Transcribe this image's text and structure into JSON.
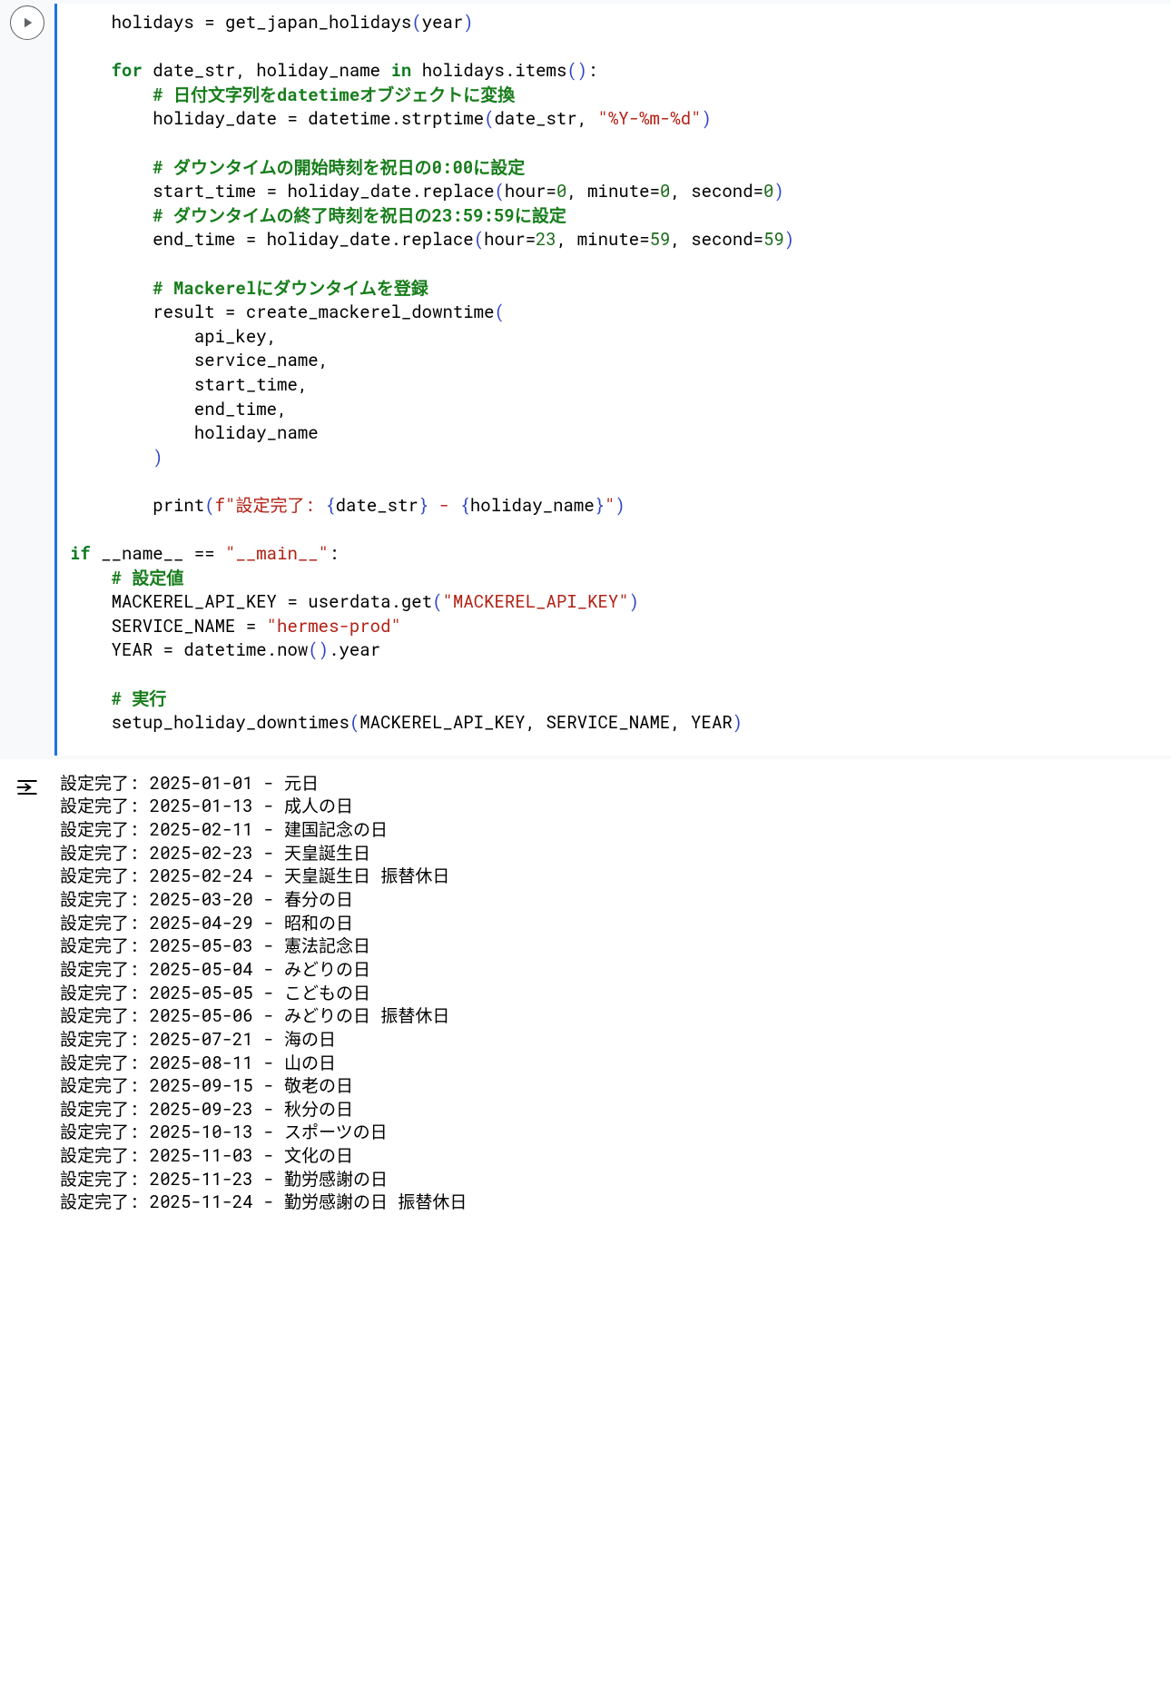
{
  "code": {
    "l01p1": "    holidays ",
    "l01p2": "=",
    "l01p3": " get_japan_holidays",
    "l01p4": "(",
    "l01p5": "year",
    "l01p6": ")",
    "blank": "",
    "l03p1": "    ",
    "l03p2": "for",
    "l03p3": " date_str",
    "l03p4": ",",
    "l03p5": " holiday_name ",
    "l03p6": "in",
    "l03p7": " holidays",
    "l03p8": ".",
    "l03p9": "items",
    "l03p10": "(",
    "l03p11": ")",
    "l03p12": ":",
    "l04p1": "        ",
    "l04p2": "# 日付文字列をdatetimeオブジェクトに変換",
    "l05p1": "        holiday_date ",
    "l05p2": "=",
    "l05p3": " datetime",
    "l05p4": ".",
    "l05p5": "strptime",
    "l05p6": "(",
    "l05p7": "date_str",
    "l05p8": ",",
    "l05p9": " ",
    "l05p10": "\"%Y-%m-%d\"",
    "l05p11": ")",
    "l07p1": "        ",
    "l07p2": "# ダウンタイムの開始時刻を祝日の0:00に設定",
    "l08p1": "        start_time ",
    "l08p2": "=",
    "l08p3": " holiday_date",
    "l08p4": ".",
    "l08p5": "replace",
    "l08p6": "(",
    "l08p7": "hour",
    "l08p8": "=",
    "l08p9": "0",
    "l08p10": ",",
    "l08p11": " minute",
    "l08p12": "=",
    "l08p13": "0",
    "l08p14": ",",
    "l08p15": " second",
    "l08p16": "=",
    "l08p17": "0",
    "l08p18": ")",
    "l09p1": "        ",
    "l09p2": "# ダウンタイムの終了時刻を祝日の23:59:59に設定",
    "l10p1": "        end_time ",
    "l10p2": "=",
    "l10p3": " holiday_date",
    "l10p4": ".",
    "l10p5": "replace",
    "l10p6": "(",
    "l10p7": "hour",
    "l10p8": "=",
    "l10p9": "23",
    "l10p10": ",",
    "l10p11": " minute",
    "l10p12": "=",
    "l10p13": "59",
    "l10p14": ",",
    "l10p15": " second",
    "l10p16": "=",
    "l10p17": "59",
    "l10p18": ")",
    "l12p1": "        ",
    "l12p2": "# Mackerelにダウンタイムを登録",
    "l13p1": "        result ",
    "l13p2": "=",
    "l13p3": " create_mackerel_downtime",
    "l13p4": "(",
    "l14p1": "            api_key",
    "l14p2": ",",
    "l15p1": "            service_name",
    "l15p2": ",",
    "l16p1": "            start_time",
    "l16p2": ",",
    "l17p1": "            end_time",
    "l17p2": ",",
    "l18p1": "            holiday_name",
    "l19p1": "        ",
    "l19p2": ")",
    "l21p1": "        ",
    "l21p2": "print",
    "l21p3": "(",
    "l21p4": "f\"設定完了: ",
    "l21p5": "{",
    "l21p6": "date_str",
    "l21p7": "}",
    "l21p8": " - ",
    "l21p9": "{",
    "l21p10": "holiday_name",
    "l21p11": "}",
    "l21p12": "\"",
    "l21p13": ")",
    "l23p1": "if",
    "l23p2": " __name__ ",
    "l23p3": "==",
    "l23p4": " ",
    "l23p5": "\"__main__\"",
    "l23p6": ":",
    "l24p1": "    ",
    "l24p2": "# 設定値",
    "l25p1": "    MACKEREL_API_KEY ",
    "l25p2": "=",
    "l25p3": " userdata",
    "l25p4": ".",
    "l25p5": "get",
    "l25p6": "(",
    "l25p7": "\"MACKEREL_API_KEY\"",
    "l25p8": ")",
    "l26p1": "    SERVICE_NAME ",
    "l26p2": "=",
    "l26p3": " ",
    "l26p4": "\"hermes-prod\"",
    "l27p1": "    YEAR ",
    "l27p2": "=",
    "l27p3": " datetime",
    "l27p4": ".",
    "l27p5": "now",
    "l27p6": "(",
    "l27p7": ")",
    "l27p8": ".",
    "l27p9": "year",
    "l29p1": "    ",
    "l29p2": "# 実行",
    "l30p1": "    setup_holiday_downtimes",
    "l30p2": "(",
    "l30p3": "MACKEREL_API_KEY",
    "l30p4": ",",
    "l30p5": " SERVICE_NAME",
    "l30p6": ",",
    "l30p7": " YEAR",
    "l30p8": ")"
  },
  "output_lines": [
    "設定完了: 2025-01-01 - 元日",
    "設定完了: 2025-01-13 - 成人の日",
    "設定完了: 2025-02-11 - 建国記念の日",
    "設定完了: 2025-02-23 - 天皇誕生日",
    "設定完了: 2025-02-24 - 天皇誕生日 振替休日",
    "設定完了: 2025-03-20 - 春分の日",
    "設定完了: 2025-04-29 - 昭和の日",
    "設定完了: 2025-05-03 - 憲法記念日",
    "設定完了: 2025-05-04 - みどりの日",
    "設定完了: 2025-05-05 - こどもの日",
    "設定完了: 2025-05-06 - みどりの日 振替休日",
    "設定完了: 2025-07-21 - 海の日",
    "設定完了: 2025-08-11 - 山の日",
    "設定完了: 2025-09-15 - 敬老の日",
    "設定完了: 2025-09-23 - 秋分の日",
    "設定完了: 2025-10-13 - スポーツの日",
    "設定完了: 2025-11-03 - 文化の日",
    "設定完了: 2025-11-23 - 勤労感謝の日",
    "設定完了: 2025-11-24 - 勤労感謝の日 振替休日"
  ]
}
